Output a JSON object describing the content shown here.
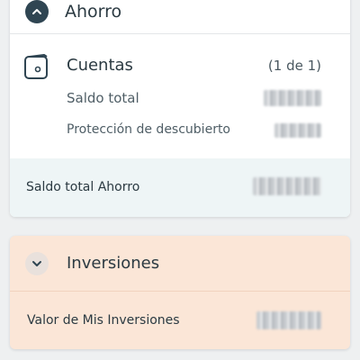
{
  "ahorro": {
    "title": "Ahorro",
    "accounts_title": "Cuentas",
    "accounts_count": "(1 de 1)",
    "saldo_total_label": "Saldo total",
    "proteccion_label": "Protección de descubierto",
    "total_label": "Saldo total Ahorro"
  },
  "inversiones": {
    "title": "Inversiones",
    "total_label": "Valor de Mis Inversiones"
  },
  "icons": {
    "collapse": "chevron-up-icon",
    "expand": "chevron-down-icon",
    "account": "wallet-icon"
  },
  "colors": {
    "accent_dark": "#2f4552",
    "inversiones_bg": "#fbe6d7",
    "total_row_bg": "#eef5f6"
  }
}
